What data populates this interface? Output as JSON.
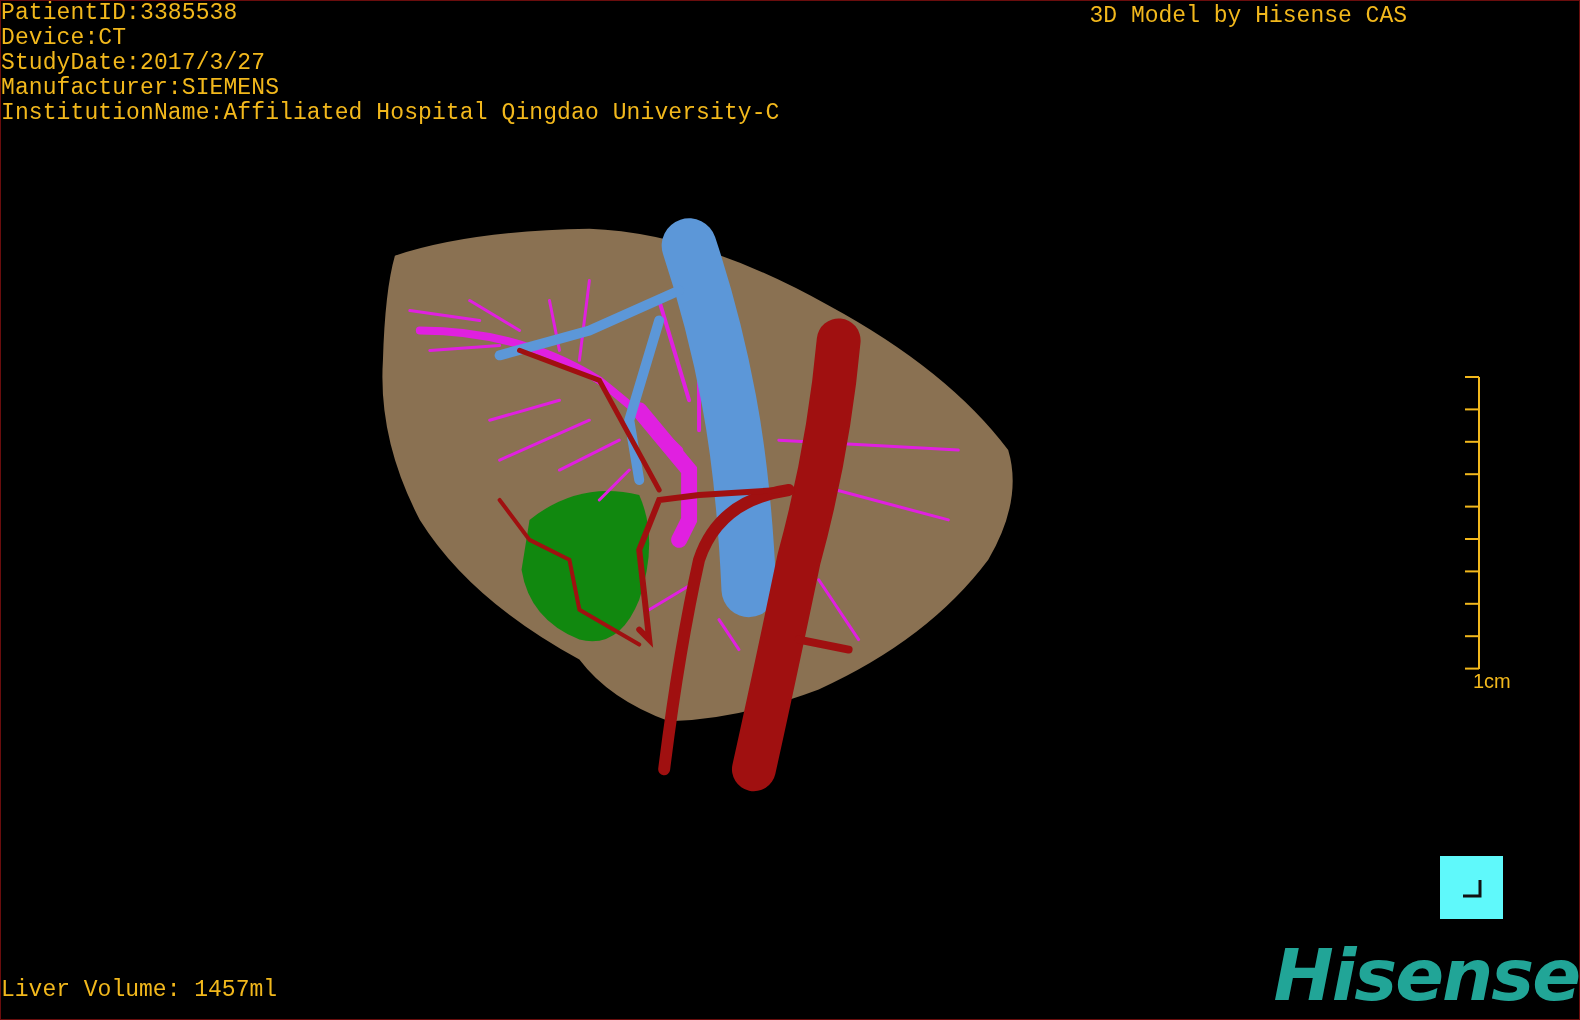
{
  "header": {
    "patient_info": [
      "PatientID:3385538",
      "Device:CT",
      "StudyDate:2017/3/27",
      "Manufacturer:SIEMENS",
      "InstitutionName:Affiliated Hospital Qingdao University-C"
    ],
    "title": "3D Model by Hisense CAS"
  },
  "scale_bar": {
    "label": "1cm"
  },
  "footer": {
    "liver_volume": "Liver Volume: 1457ml",
    "logo": "Hisense"
  }
}
